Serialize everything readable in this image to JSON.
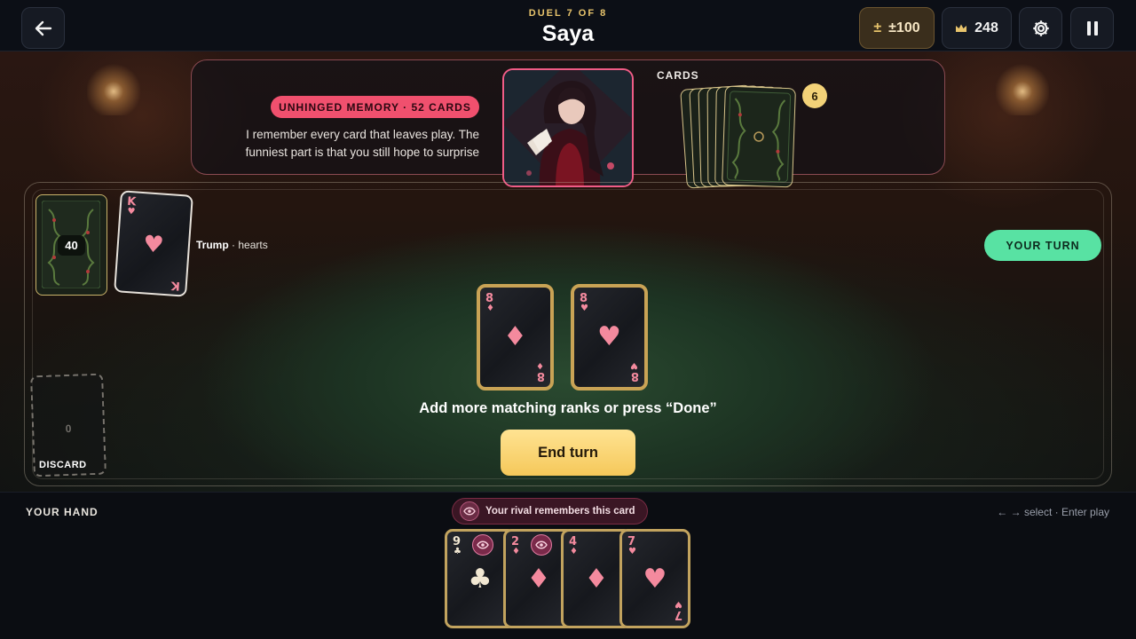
{
  "header": {
    "duel_label": "DUEL 7 OF 8",
    "opponent_name": "Saya",
    "stake": "±100",
    "stake_icon": "plus-minus-icon",
    "score": "248",
    "score_icon": "crown-icon"
  },
  "opponent": {
    "badge": "UNHINGED MEMORY · 52 CARDS",
    "quote": "I remember every card that leaves play. The funniest part is that you still hope to surprise",
    "cards_label": "CARDS",
    "card_count": "6"
  },
  "table": {
    "deck_count": "40",
    "trump_card": {
      "rank": "K",
      "suit": "♥"
    },
    "trump_label": "Trump",
    "trump_suit": "· hearts",
    "turn_badge": "YOUR TURN",
    "played_cards": [
      {
        "rank": "8",
        "suit": "♦"
      },
      {
        "rank": "8",
        "suit": "♥"
      }
    ],
    "instruction": "Add more matching ranks or press “Done”",
    "end_turn_label": "End turn",
    "discard_count": "0",
    "discard_label": "DISCARD"
  },
  "hand": {
    "label": "YOUR HAND",
    "rival_notice": "Your rival remembers this card",
    "hint": "← → select · Enter play",
    "cards": [
      {
        "rank": "9",
        "suit": "♣",
        "remembered": true
      },
      {
        "rank": "2",
        "suit": "♦",
        "remembered": true
      },
      {
        "rank": "4",
        "suit": "♦",
        "remembered": false
      },
      {
        "rank": "7",
        "suit": "♥",
        "remembered": false
      }
    ]
  },
  "colors": {
    "accent_gold": "#f5c85a",
    "turn_green": "#58e2a3",
    "memory_pink": "#f0506e",
    "red_suit": "#f48a9e",
    "black_suit": "#f1e7d2"
  }
}
